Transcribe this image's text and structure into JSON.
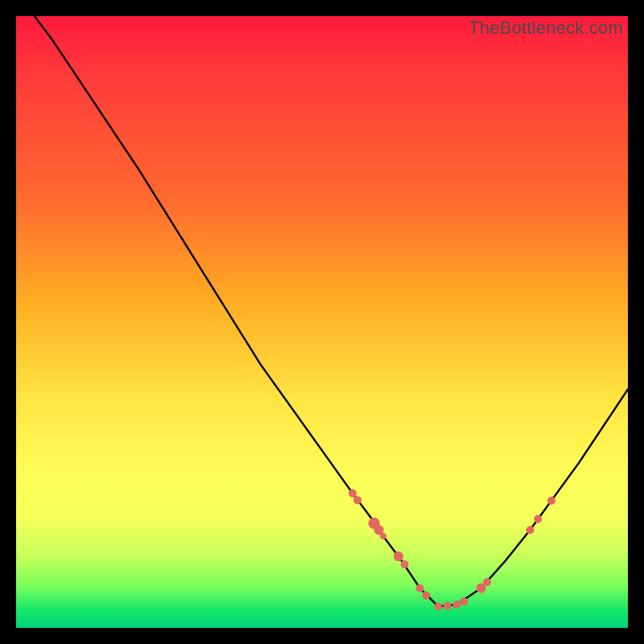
{
  "watermark": "TheBottleneck.com",
  "colors": {
    "curve": "#000000",
    "marker_fill": "#e2675f",
    "marker_stroke": "#b84a44"
  },
  "chart_data": {
    "type": "line",
    "title": "",
    "xlabel": "",
    "ylabel": "",
    "xlim": [
      0,
      100
    ],
    "ylim": [
      0,
      100
    ],
    "note": "Axes are implied 0–100% each; no ticks or labels shown. Bottleneck-style V-curve with minimum near x≈69.",
    "series": [
      {
        "name": "bottleneck-curve",
        "x": [
          3,
          6,
          10,
          15,
          20,
          25,
          30,
          35,
          40,
          45,
          50,
          55,
          58,
          60,
          63,
          66,
          69,
          72,
          76,
          80,
          84,
          88,
          92,
          96,
          100
        ],
        "y": [
          100,
          96,
          90,
          82.5,
          75,
          67,
          59,
          51,
          43,
          36,
          29,
          22,
          18,
          15,
          11,
          6.5,
          3.5,
          3.8,
          6.5,
          11,
          16,
          21.5,
          27,
          33,
          39
        ]
      }
    ],
    "markers": [
      {
        "x": 55.0,
        "y": 22.0,
        "r": 5
      },
      {
        "x": 55.8,
        "y": 20.9,
        "r": 5
      },
      {
        "x": 58.5,
        "y": 17.1,
        "r": 7
      },
      {
        "x": 59.3,
        "y": 16.0,
        "r": 6
      },
      {
        "x": 60.0,
        "y": 15.0,
        "r": 4
      },
      {
        "x": 62.5,
        "y": 11.7,
        "r": 6
      },
      {
        "x": 63.5,
        "y": 10.4,
        "r": 5
      },
      {
        "x": 66.0,
        "y": 6.5,
        "r": 5
      },
      {
        "x": 67.0,
        "y": 5.3,
        "r": 5
      },
      {
        "x": 69.0,
        "y": 3.5,
        "r": 5
      },
      {
        "x": 70.5,
        "y": 3.6,
        "r": 5
      },
      {
        "x": 72.0,
        "y": 3.8,
        "r": 5
      },
      {
        "x": 73.2,
        "y": 4.3,
        "r": 5
      },
      {
        "x": 76.0,
        "y": 6.5,
        "r": 6
      },
      {
        "x": 77.0,
        "y": 7.5,
        "r": 5
      },
      {
        "x": 84.0,
        "y": 16.0,
        "r": 5
      },
      {
        "x": 85.3,
        "y": 17.8,
        "r": 5
      },
      {
        "x": 87.5,
        "y": 20.8,
        "r": 5
      }
    ]
  }
}
